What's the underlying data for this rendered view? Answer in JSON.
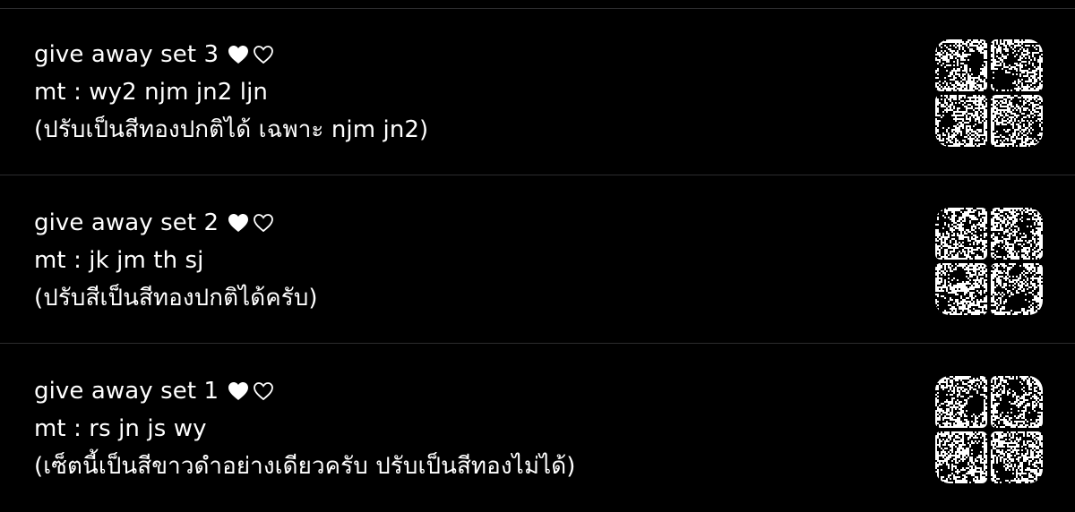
{
  "items": [
    {
      "title": "give away set 3",
      "detail": "mt : wy2 njm jn2 ljn",
      "note": "(ปรับเป็นสีทองปกติได้ เฉพาะ njm jn2)",
      "hearts": [
        "filled-heart-icon",
        "outline-heart-icon"
      ],
      "thumbnail": "photo-grid-thumbnail"
    },
    {
      "title": "give away set 2",
      "detail": "mt : jk jm th sj",
      "note": "(ปรับสีเป็นสีทองปกติได้ครับ)",
      "hearts": [
        "filled-heart-icon",
        "outline-heart-icon"
      ],
      "thumbnail": "photo-grid-thumbnail"
    },
    {
      "title": "give away set 1",
      "detail": "mt : rs jn js wy",
      "note": "(เซ็ตนี้เป็นสีขาวดำอย่างเดียวครับ ปรับเป็นสีทองไม่ได้)",
      "hearts": [
        "filled-heart-icon",
        "outline-heart-icon"
      ],
      "thumbnail": "photo-grid-thumbnail"
    }
  ],
  "colors": {
    "background": "#000000",
    "text": "#ffffff",
    "divider": "#2c2c2e"
  }
}
